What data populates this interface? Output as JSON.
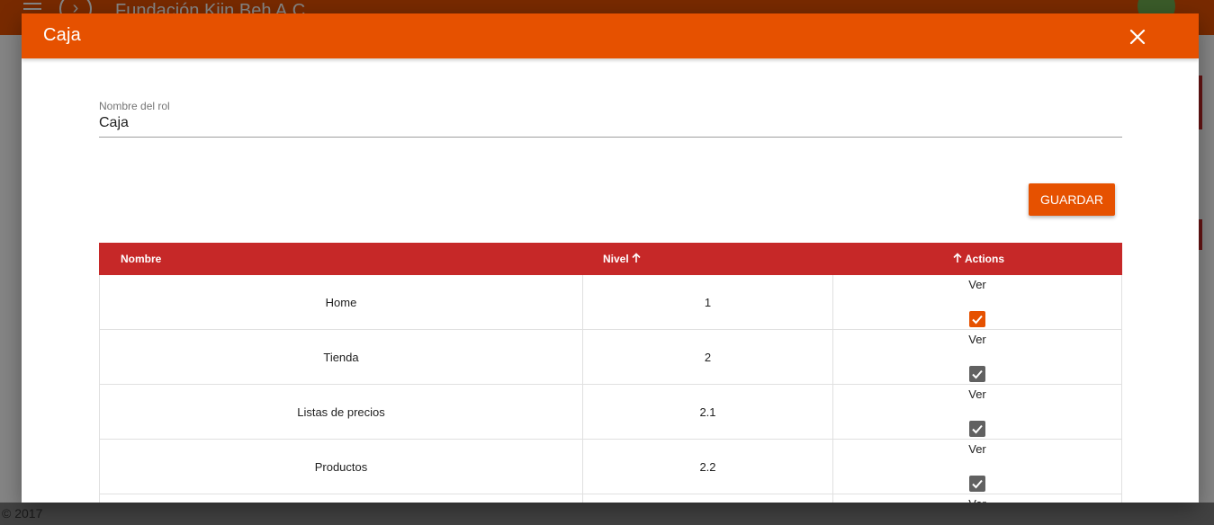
{
  "app": {
    "title": "Fundación Kiin Beh A.C.",
    "footer": "© 2017"
  },
  "dialog": {
    "title": "Caja",
    "close_icon": "close-icon",
    "field": {
      "label": "Nombre del rol",
      "value": "Caja"
    },
    "save_label": "GUARDAR"
  },
  "table": {
    "headers": {
      "nombre": "Nombre",
      "nivel": "Nivel",
      "actions": "Actions"
    },
    "rows": [
      {
        "nombre": "Home",
        "nivel": "1",
        "action_label": "Ver",
        "checked": true,
        "active": true
      },
      {
        "nombre": "Tienda",
        "nivel": "2",
        "action_label": "Ver",
        "checked": true,
        "active": false
      },
      {
        "nombre": "Listas de precios",
        "nivel": "2.1",
        "action_label": "Ver",
        "checked": true,
        "active": false
      },
      {
        "nombre": "Productos",
        "nivel": "2.2",
        "action_label": "Ver",
        "checked": true,
        "active": false
      },
      {
        "nombre": "",
        "nivel": "",
        "action_label": "Ver",
        "checked": true,
        "active": false
      }
    ]
  },
  "colors": {
    "primary": "#e65100",
    "table_header": "#c62828",
    "checkbox_active": "#e65100",
    "checkbox_inactive": "#616161"
  }
}
